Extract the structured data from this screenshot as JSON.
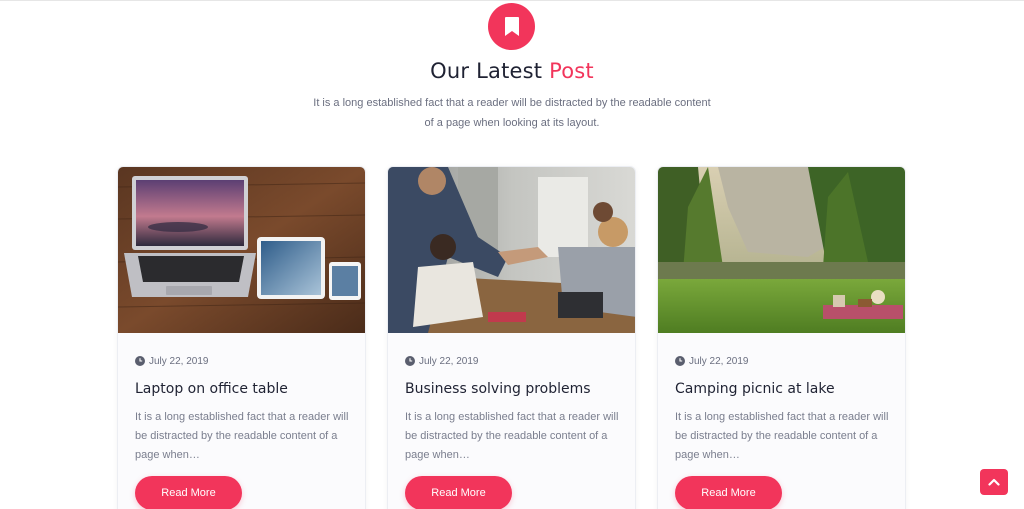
{
  "section": {
    "badge_icon": "bookmark-icon",
    "title_main": "Our Latest ",
    "title_accent": "Post",
    "subtitle": "It is a long established fact that a reader will be distracted by the readable content of a page when looking at its layout."
  },
  "colors": {
    "accent": "#f2355b",
    "heading": "#1f2233",
    "body_text": "#7a7e8e"
  },
  "posts": [
    {
      "image": "laptop-tablet-phone-photo",
      "date_icon": "clock-icon",
      "date": "July 22, 2019",
      "title": "Laptop on office table",
      "excerpt": "It is a long established fact that a reader will be distracted by the readable content of a page when…",
      "button": "Read More"
    },
    {
      "image": "business-handshake-photo",
      "date_icon": "clock-icon",
      "date": "July 22, 2019",
      "title": "Business solving problems",
      "excerpt": "It is a long established fact that a reader will be distracted by the readable content of a page when…",
      "button": "Read More"
    },
    {
      "image": "lake-picnic-photo",
      "date_icon": "clock-icon",
      "date": "July 22, 2019",
      "title": "Camping picnic at lake",
      "excerpt": "It is a long established fact that a reader will be distracted by the readable content of a page when…",
      "button": "Read More"
    }
  ],
  "scroll_top_icon": "chevron-up-icon"
}
